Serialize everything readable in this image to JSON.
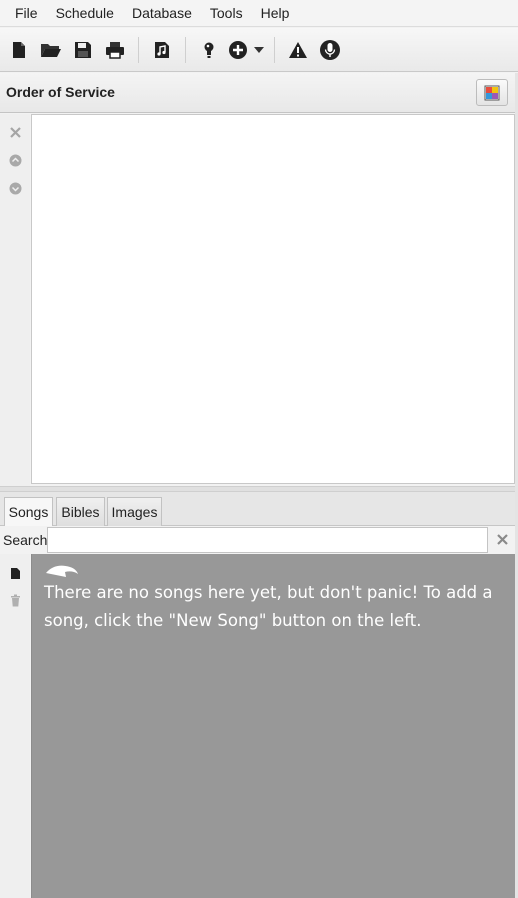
{
  "menu": [
    "File",
    "Schedule",
    "Database",
    "Tools",
    "Help"
  ],
  "toolbar": {
    "buttons": [
      "new-schedule",
      "open-schedule",
      "save-schedule",
      "print-schedule",
      "export-songs",
      "bulb",
      "add",
      "alert",
      "microphone"
    ]
  },
  "order_of_service": {
    "title": "Order of Service",
    "side_buttons": [
      "remove",
      "move-up",
      "move-down"
    ]
  },
  "tabs": [
    {
      "label": "Songs",
      "active": true
    },
    {
      "label": "Bibles",
      "active": false
    },
    {
      "label": "Images",
      "active": false
    }
  ],
  "search": {
    "label": "Search",
    "value": "",
    "placeholder": ""
  },
  "songs": {
    "empty_message": "There are no songs here yet, but don't panic! To add a song, click the \"New Song\" button on the left."
  },
  "colors": {
    "panel_gray": "#989898",
    "icon_dark": "#222222",
    "icon_light": "#a5a5a5"
  }
}
